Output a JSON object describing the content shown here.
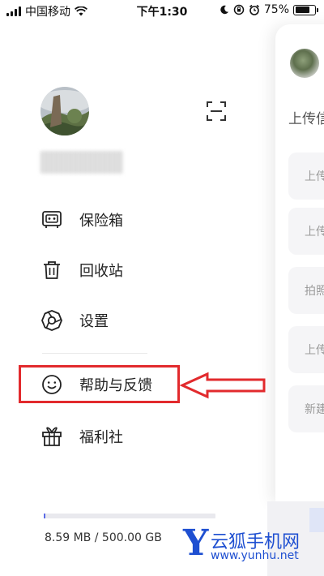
{
  "status_bar": {
    "carrier": "中国移动",
    "time": "下午1:30",
    "battery_percent": "75%",
    "battery_level": 0.75,
    "icons": [
      "signal-icon",
      "wifi-icon",
      "moon-icon",
      "orientation-lock-icon",
      "alarm-icon",
      "battery-icon"
    ]
  },
  "drawer": {
    "menu": [
      {
        "id": "vault",
        "label": "保险箱",
        "icon": "safe-icon"
      },
      {
        "id": "recycle",
        "label": "回收站",
        "icon": "trash-icon"
      },
      {
        "id": "settings",
        "label": "设置",
        "icon": "settings-icon"
      },
      {
        "id": "help",
        "label": "帮助与反馈",
        "icon": "smiley-icon"
      },
      {
        "id": "welfare",
        "label": "福利社",
        "icon": "gift-icon"
      }
    ],
    "storage": {
      "text": "8.59 MB / 500.00 GB",
      "used_fraction": 1.72e-05
    },
    "scan_icon": "scan-icon"
  },
  "background_panel": {
    "title": "上传信",
    "items": [
      "上传",
      "上传",
      "拍照",
      "上传",
      "新建"
    ]
  },
  "annotation": {
    "highlight_color": "#e22a2d",
    "target": "帮助与反馈"
  },
  "watermark": {
    "logo": "Y",
    "text": "云狐手机网",
    "url": "www.yunhu.net"
  },
  "colors": {
    "accent": "#5b6be6",
    "annotation": "#e22a2d",
    "watermark": "#1e4fd1"
  }
}
